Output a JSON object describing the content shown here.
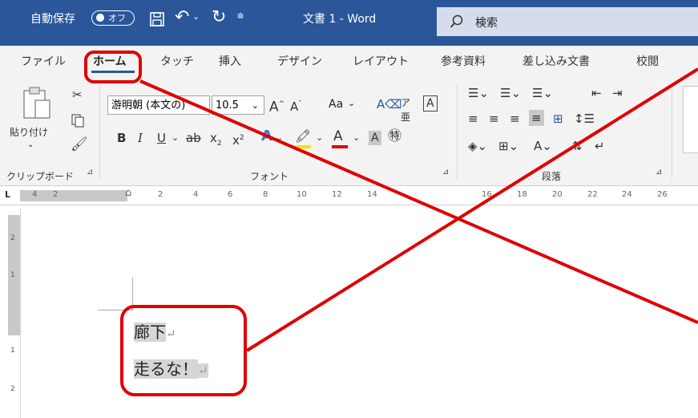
{
  "titlebar": {
    "autosave_label": "自動保存",
    "autosave_toggle": "オフ",
    "doc_title": "文書 1  -  Word",
    "search_placeholder": "検索"
  },
  "tabs": [
    {
      "label": "ファイル"
    },
    {
      "label": "ホーム"
    },
    {
      "label": "タッチ"
    },
    {
      "label": "挿入"
    },
    {
      "label": "デザイン"
    },
    {
      "label": "レイアウト"
    },
    {
      "label": "参考資料"
    },
    {
      "label": "差し込み文書"
    },
    {
      "label": "校閲"
    }
  ],
  "ribbon": {
    "clipboard": {
      "paste_label": "貼り付け",
      "group_label": "クリップボード"
    },
    "font": {
      "font_name": "游明朝 (本文の)",
      "font_size": "10.5",
      "aa_label": "Aa",
      "group_label": "フォント"
    },
    "paragraph": {
      "group_label": "段落"
    }
  },
  "ruler_numbers": [
    "4",
    "2",
    "2",
    "4",
    "6",
    "8",
    "10",
    "12",
    "14",
    "16",
    "18",
    "20",
    "22",
    "24",
    "26"
  ],
  "vruler_numbers": [
    "2",
    "1",
    "1",
    "2"
  ],
  "document": {
    "lines": [
      {
        "text": "廊下",
        "mark": "↵"
      },
      {
        "text": "走るな！",
        "mark": "↵"
      }
    ]
  },
  "colors": {
    "accent": "#2b579a",
    "annotation": "#e00000",
    "highlight": "#f2e400",
    "font_color": "#e00000"
  }
}
